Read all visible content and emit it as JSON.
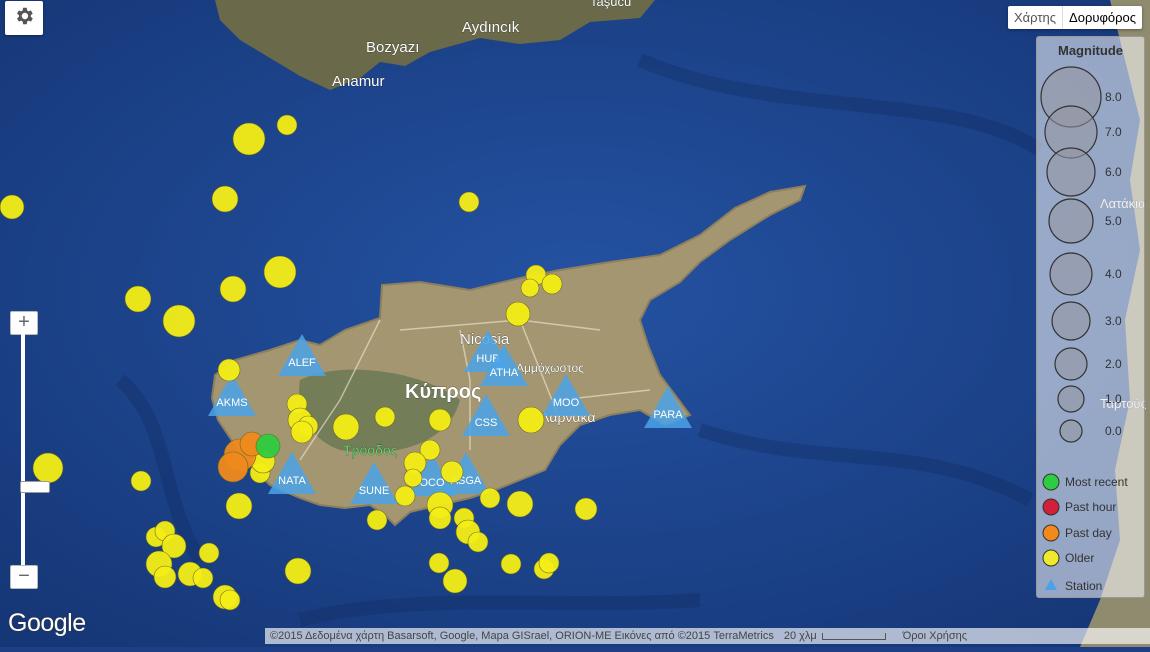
{
  "map_type": {
    "map_label": "Χάρτης",
    "satellite_label": "Δορυφόρος",
    "active": "satellite"
  },
  "zoom": {
    "in_label": "+",
    "out_label": "−"
  },
  "places": {
    "tasucu": "Taşucu",
    "aydincik": "Aydıncık",
    "bozyazi": "Bozyazı",
    "anamur": "Anamur",
    "nicosia": "Nicosia",
    "ammochostos_frag": "Αμμόχωστος",
    "kypros": "Κύπρος",
    "troodos": "Τρόοδος",
    "larnaka_frag": "Λάρνακα",
    "right_1": "Λατάκια",
    "right_2": "Ταρτούς"
  },
  "stations": [
    "ALEF",
    "AKMS",
    "HUB",
    "ATHA",
    "MOO",
    "PARA",
    "CSS",
    "NATA",
    "SUNE",
    "OCO",
    "ASGA"
  ],
  "legend": {
    "title": "Magnitude",
    "magnitudes": [
      "8.0",
      "7.0",
      "6.0",
      "5.0",
      "4.0",
      "3.0",
      "2.0",
      "1.0",
      "0.0"
    ],
    "categories": [
      {
        "label": "Most recent",
        "color": "#2ecc40"
      },
      {
        "label": "Past hour",
        "color": "#d0203a"
      },
      {
        "label": "Past day",
        "color": "#f08a1d"
      },
      {
        "label": "Older",
        "color": "#eeea2a"
      }
    ],
    "station_label": "Station"
  },
  "colors": {
    "sea": "#1c3f86",
    "land": "#a59672",
    "quake_older": "#f5ee16",
    "quake_past_day": "#f08a1d",
    "quake_recent": "#2ecc40",
    "station": "#4aa3e8"
  },
  "attribution": {
    "text": "©2015 Δεδομένα χάρτη Basarsoft, Google, Mapa GISrael, ORION-ME Εικόνες από ©2015 TerraMetrics",
    "scale": "20 χλμ",
    "terms": "Όροι Χρήσης"
  },
  "logo": "Google",
  "settings_icon": "gear-icon"
}
